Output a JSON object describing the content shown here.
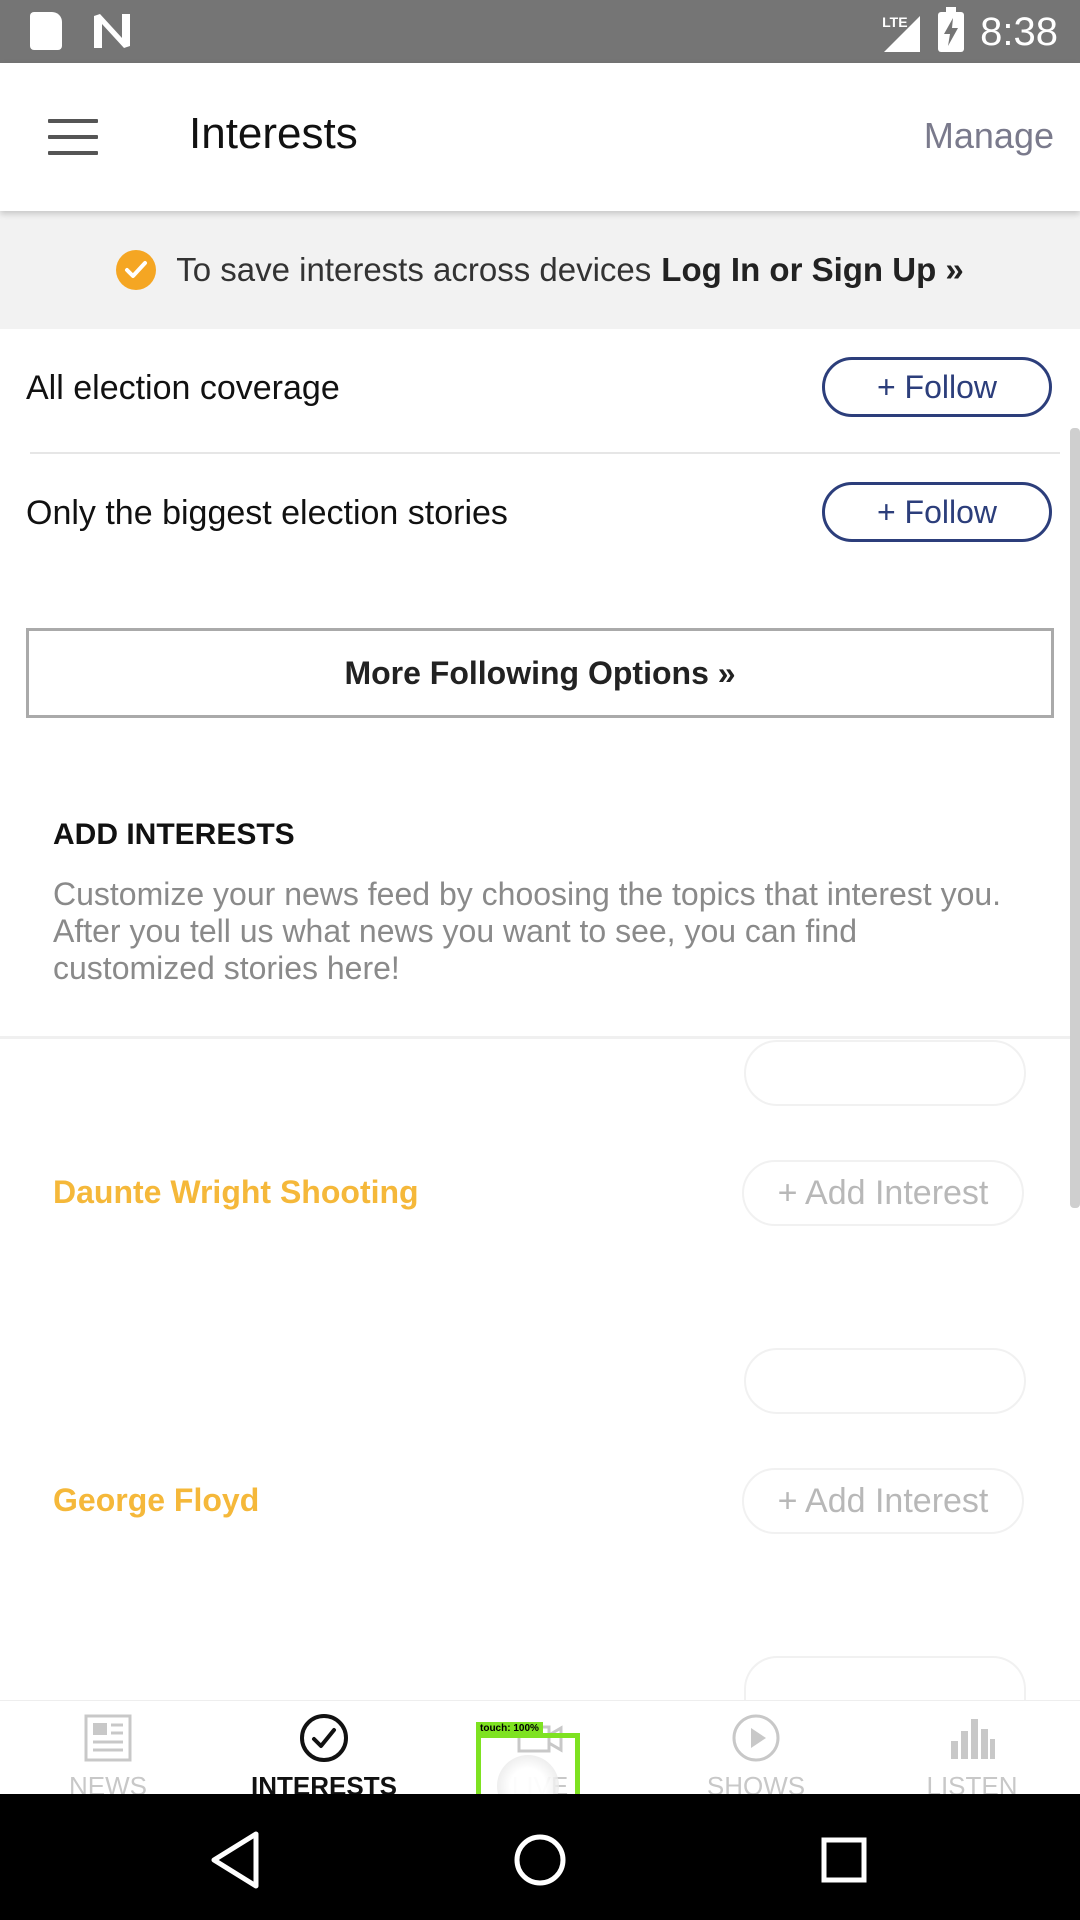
{
  "status_bar": {
    "time": "8:38",
    "network": "LTE"
  },
  "app_bar": {
    "title": "Interests",
    "manage_label": "Manage"
  },
  "banner": {
    "text": "To save interests across devices",
    "link_label": "Log In or Sign Up »",
    "accent_color": "#f5a623"
  },
  "follow_rows": [
    {
      "label": "All election coverage",
      "button_label": "+ Follow"
    },
    {
      "label": "Only the biggest election stories",
      "button_label": "+ Follow"
    }
  ],
  "more_options_label": "More Following Options »",
  "add_interests": {
    "heading": "ADD INTERESTS",
    "description": "Customize your news feed by choosing the topics that interest you. After you tell us what news you want to see, you can find customized stories here!",
    "items": [
      {
        "name": "Daunte Wright Shooting",
        "button_label": "+ Add Interest"
      },
      {
        "name": "George Floyd",
        "button_label": "+ Add Interest"
      }
    ]
  },
  "bottom_nav": {
    "items": [
      {
        "label": "NEWS",
        "icon": "newspaper-icon",
        "active": false
      },
      {
        "label": "INTERESTS",
        "icon": "check-circle-icon",
        "active": true
      },
      {
        "label": "LIVE",
        "icon": "video-camera-icon",
        "active": false
      },
      {
        "label": "SHOWS",
        "icon": "play-circle-icon",
        "active": false
      },
      {
        "label": "LISTEN",
        "icon": "equalizer-icon",
        "active": false
      }
    ]
  },
  "touch_overlay": {
    "label": "touch: 100%"
  }
}
